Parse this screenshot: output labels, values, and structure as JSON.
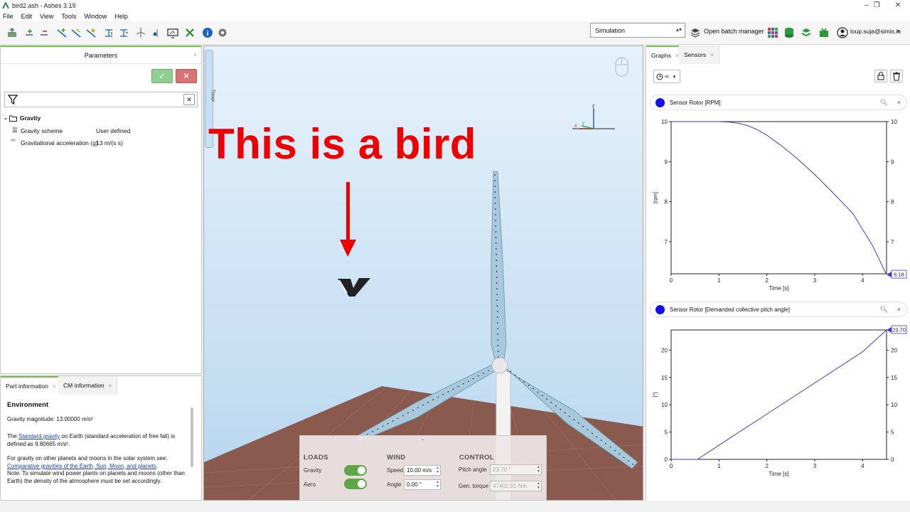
{
  "window": {
    "title": "bird2.ash - Ashes 3.19",
    "controls": [
      "–",
      "❐",
      "✕"
    ]
  },
  "menu": [
    "File",
    "Edit",
    "View",
    "Tools",
    "Window",
    "Help"
  ],
  "toolbar": {
    "mode_select": "Simulation",
    "batch_manager_label": "Open batch manager",
    "user": "loup.suja@simis.io"
  },
  "parameters": {
    "title": "Parameters",
    "ok_icon": "✓",
    "cancel_icon": "✕",
    "clear_filter_icon": "✕",
    "group": "Gravity",
    "rows": [
      {
        "icon": "☰",
        "name": "Gravity scheme",
        "value": "User defined"
      },
      {
        "icon": "¹²³",
        "name": "Gravitational acceleration (g)",
        "value": "13 m/(s s)"
      }
    ]
  },
  "info": {
    "tabs": [
      "Part information",
      "CM information"
    ],
    "heading": "Environment",
    "magnitude": "Gravity magnitude: 13.00000 m/s²",
    "p1_pre": "The ",
    "p1_link": "Standard gravity",
    "p1_post": " on Earth (standard acceleration of free fall) is defined as 9.80665 m/s².",
    "p2_pre": "For gravity on other planets and moons in the solar system see:",
    "p2_link": "Comparative gravities of the Earth, Sun, Moon, and planets",
    "p2_post": ".",
    "p3": "Note: To simulate wind power plants on planets and moons (other than Earth) the density of the atmosphere must be set accordingly."
  },
  "viewport": {
    "timer_label": "Timer",
    "annotation": "This is a bird",
    "axis_z": "z",
    "axis_x": "x",
    "axis_y": "y"
  },
  "loads_panel": {
    "collapse": "-",
    "loads_title": "LOADS",
    "gravity_label": "Gravity",
    "aero_label": "Aero",
    "gravity_on": true,
    "aero_on": true,
    "wind_title": "WIND",
    "speed_label": "Speed",
    "speed_value": "10.00 m/s",
    "angle_label": "Angle",
    "angle_value": "0.00 °",
    "control_title": "CONTROL",
    "pitch_label": "Pitch angle",
    "pitch_value": "23.70 °",
    "torque_label": "Gen. torque",
    "torque_value": "47402.91 Nm"
  },
  "graphs": {
    "tabs": [
      "Graphs",
      "Sensors"
    ],
    "time_selector": "∞",
    "graph1": {
      "title": "Sensor Rotor [RPM]",
      "ylabel": "[rpm]",
      "xlabel": "Time [s]",
      "end_label": "6.18"
    },
    "graph2": {
      "title": "Sensor Rotor [Demanded collective pitch angle]",
      "ylabel": "[°]",
      "xlabel": "Time [s]",
      "end_label": "23.70"
    }
  },
  "chart_data": [
    {
      "type": "line",
      "title": "Sensor Rotor [RPM]",
      "xlabel": "Time [s]",
      "ylabel": "[rpm]",
      "xlim": [
        0,
        4.5
      ],
      "ylim": [
        6.2,
        10
      ],
      "xticks": [
        0,
        1,
        2,
        3,
        4
      ],
      "yticks": [
        7,
        8,
        9,
        10
      ],
      "series": [
        {
          "name": "Sensor Rotor [RPM]",
          "color": "#3a3ad8",
          "x": [
            0,
            0.5,
            1.0,
            1.2,
            1.4,
            1.6,
            1.8,
            2.0,
            2.3,
            2.6,
            3.0,
            3.4,
            3.8,
            4.2,
            4.5
          ],
          "y": [
            10,
            10,
            10,
            9.99,
            9.96,
            9.9,
            9.8,
            9.66,
            9.4,
            9.11,
            8.68,
            8.2,
            7.7,
            6.92,
            6.18
          ]
        }
      ],
      "end_value": "6.18",
      "grid": false
    },
    {
      "type": "line",
      "title": "Sensor Rotor [Demanded collective pitch angle]",
      "xlabel": "Time [s]",
      "ylabel": "[°]",
      "xlim": [
        0,
        4.5
      ],
      "ylim": [
        0,
        23.7
      ],
      "xticks": [
        0,
        1,
        2,
        3,
        4
      ],
      "yticks": [
        0,
        5,
        10,
        15,
        20
      ],
      "series": [
        {
          "name": "Sensor Rotor [Demanded collective pitch angle]",
          "color": "#3a3ad8",
          "x": [
            0,
            0.55,
            1.0,
            2.0,
            3.0,
            4.0,
            4.5
          ],
          "y": [
            0,
            0,
            2.6,
            8.3,
            14.0,
            19.7,
            23.7
          ]
        }
      ],
      "end_value": "23.70",
      "grid": false
    }
  ]
}
